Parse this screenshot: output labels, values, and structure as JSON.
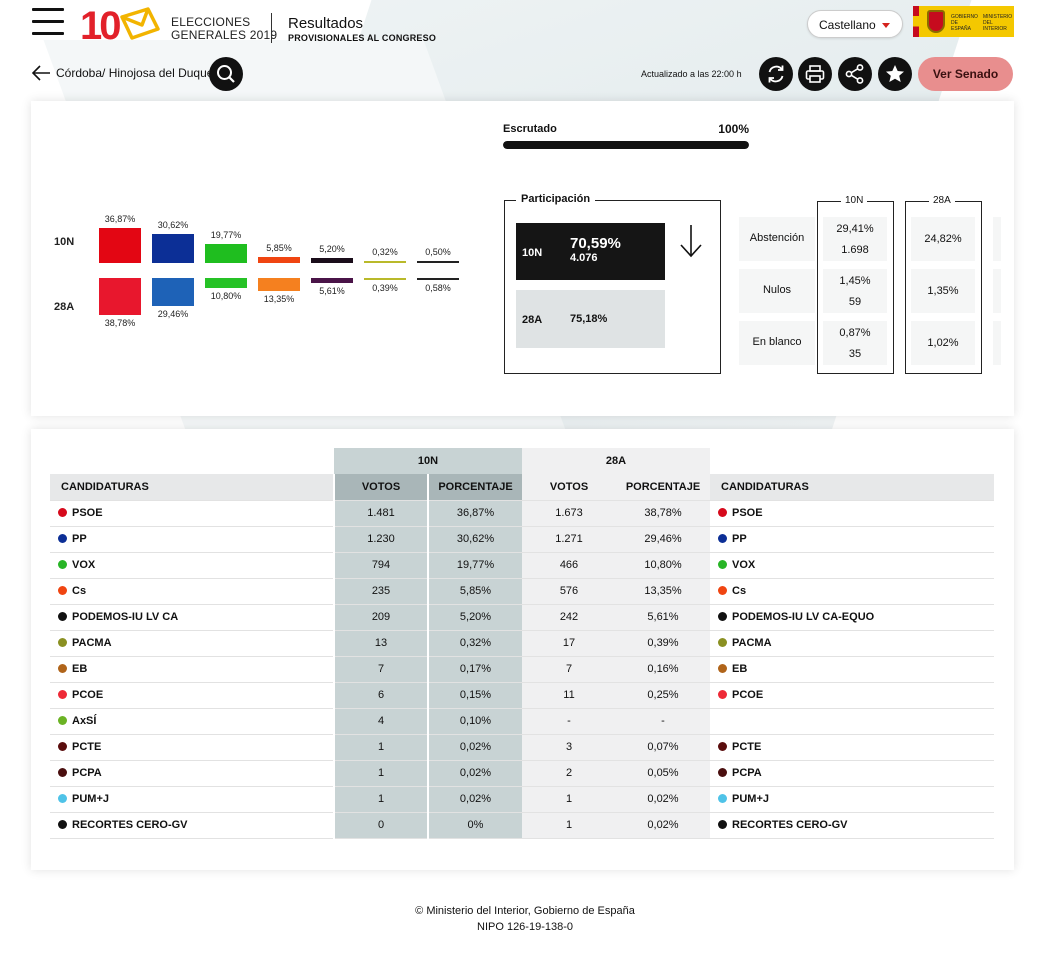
{
  "header": {
    "logo_number": "10",
    "logo_line1": "ELECCIONES",
    "logo_line2": "GENERALES 2019",
    "title": "Resultados",
    "subtitle": "PROVISIONALES AL CONGRESO",
    "language": "Castellano",
    "gov_line1": "GOBIERNO DE ESPAÑA",
    "gov_line2": "MINISTERIO DEL INTERIOR"
  },
  "nav": {
    "location": "Córdoba/ Hinojosa del Duque",
    "updated": "Actualizado a las 22:00 h",
    "senado_label": "Ver Senado"
  },
  "bars": {
    "row_10n": "10N",
    "row_28a": "28A",
    "parties": [
      {
        "color": "#e30613",
        "color28": "#e8172d",
        "v10": "36,87%",
        "v28": "38,78%",
        "p10": 36.87,
        "p28": 38.78
      },
      {
        "color": "#0c2f96",
        "color28": "#1e62b7",
        "v10": "30,62%",
        "v28": "29,46%",
        "p10": 30.62,
        "p28": 29.46
      },
      {
        "color": "#1fbe1f",
        "color28": "#26c226",
        "v10": "19,77%",
        "v28": "10,80%",
        "p10": 19.77,
        "p28": 10.8
      },
      {
        "color": "#f04511",
        "color28": "#f5801f",
        "v10": "5,85%",
        "v28": "13,35%",
        "p10": 5.85,
        "p28": 13.35
      },
      {
        "color": "#1a0d1a",
        "color28": "#4a1448",
        "v10": "5,20%",
        "v28": "5,61%",
        "p10": 5.2,
        "p28": 5.61
      },
      {
        "color": "#b9b92a",
        "color28": "#b9b92a",
        "v10": "0,32%",
        "v28": "0,39%",
        "p10": 0.32,
        "p28": 0.39
      },
      {
        "color": "#222222",
        "color28": "#222222",
        "v10": "0,50%",
        "v28": "0,58%",
        "p10": 0.5,
        "p28": 0.58
      }
    ]
  },
  "scrutiny": {
    "label": "Escrutado",
    "value": "100%",
    "fraction": 1.0
  },
  "participation": {
    "label": "Participación",
    "n10_key": "10N",
    "n10_pct": "70,59%",
    "n10_votes": "4.076",
    "a28_key": "28A",
    "a28_pct": "75,18%"
  },
  "side": {
    "labels": [
      "Abstención",
      "Nulos",
      "En blanco"
    ],
    "col_10n": "10N",
    "col_28a": "28A",
    "n10": [
      [
        "29,41%",
        "1.698"
      ],
      [
        "1,45%",
        "59"
      ],
      [
        "0,87%",
        "35"
      ]
    ],
    "a28": [
      "24,82%",
      "1,35%",
      "1,02%"
    ]
  },
  "table": {
    "group_10n": "10N",
    "group_28a": "28A",
    "h_cand": "CANDIDATURAS",
    "h_votos": "VOTOS",
    "h_pct": "PORCENTAJE",
    "rows": [
      {
        "n10": "PSOE",
        "c10": "#d60a1c",
        "v10": "1.481",
        "p10": "36,87%",
        "v28": "1.673",
        "p28": "38,78%",
        "n28": "PSOE",
        "c28": "#d60a1c"
      },
      {
        "n10": "PP",
        "c10": "#0c2f96",
        "v10": "1.230",
        "p10": "30,62%",
        "v28": "1.271",
        "p28": "29,46%",
        "n28": "PP",
        "c28": "#0c2f96"
      },
      {
        "n10": "VOX",
        "c10": "#28b526",
        "v10": "794",
        "p10": "19,77%",
        "v28": "466",
        "p28": "10,80%",
        "n28": "VOX",
        "c28": "#28b526"
      },
      {
        "n10": "Cs",
        "c10": "#f04511",
        "v10": "235",
        "p10": "5,85%",
        "v28": "576",
        "p28": "13,35%",
        "n28": "Cs",
        "c28": "#f04511"
      },
      {
        "n10": "PODEMOS-IU LV CA",
        "c10": "#111111",
        "v10": "209",
        "p10": "5,20%",
        "v28": "242",
        "p28": "5,61%",
        "n28": "PODEMOS-IU LV CA-EQUO",
        "c28": "#111111"
      },
      {
        "n10": "PACMA",
        "c10": "#8a9022",
        "v10": "13",
        "p10": "0,32%",
        "v28": "17",
        "p28": "0,39%",
        "n28": "PACMA",
        "c28": "#8a9022"
      },
      {
        "n10": "EB",
        "c10": "#b0641a",
        "v10": "7",
        "p10": "0,17%",
        "v28": "7",
        "p28": "0,16%",
        "n28": "EB",
        "c28": "#b0641a"
      },
      {
        "n10": "PCOE",
        "c10": "#ee2a37",
        "v10": "6",
        "p10": "0,15%",
        "v28": "11",
        "p28": "0,25%",
        "n28": "PCOE",
        "c28": "#ee2a37"
      },
      {
        "n10": "AxSÍ",
        "c10": "#6bb324",
        "v10": "4",
        "p10": "0,10%",
        "v28": "-",
        "p28": "-",
        "n28": "",
        "c28": ""
      },
      {
        "n10": "PCTE",
        "c10": "#5a0d0d",
        "v10": "1",
        "p10": "0,02%",
        "v28": "3",
        "p28": "0,07%",
        "n28": "PCTE",
        "c28": "#5a0d0d"
      },
      {
        "n10": "PCPA",
        "c10": "#4a0f0f",
        "v10": "1",
        "p10": "0,02%",
        "v28": "2",
        "p28": "0,05%",
        "n28": "PCPA",
        "c28": "#4a0f0f"
      },
      {
        "n10": "PUM+J",
        "c10": "#4fc3e8",
        "v10": "1",
        "p10": "0,02%",
        "v28": "1",
        "p28": "0,02%",
        "n28": "PUM+J",
        "c28": "#4fc3e8"
      },
      {
        "n10": "RECORTES CERO-GV",
        "c10": "#111111",
        "v10": "0",
        "p10": "0%",
        "v28": "1",
        "p28": "0,02%",
        "n28": "RECORTES CERO-GV",
        "c28": "#111111"
      }
    ]
  },
  "footer": {
    "line1": "© Ministerio del Interior, Gobierno de España",
    "line2": "NIPO 126-19-138-0"
  },
  "icons": {
    "menu": "hamburger-icon",
    "back": "arrow-left-icon",
    "search": "search-icon",
    "refresh": "refresh-icon",
    "print": "printer-icon",
    "share": "share-icon",
    "favorite": "star-icon",
    "trend": "arrow-down-icon"
  }
}
